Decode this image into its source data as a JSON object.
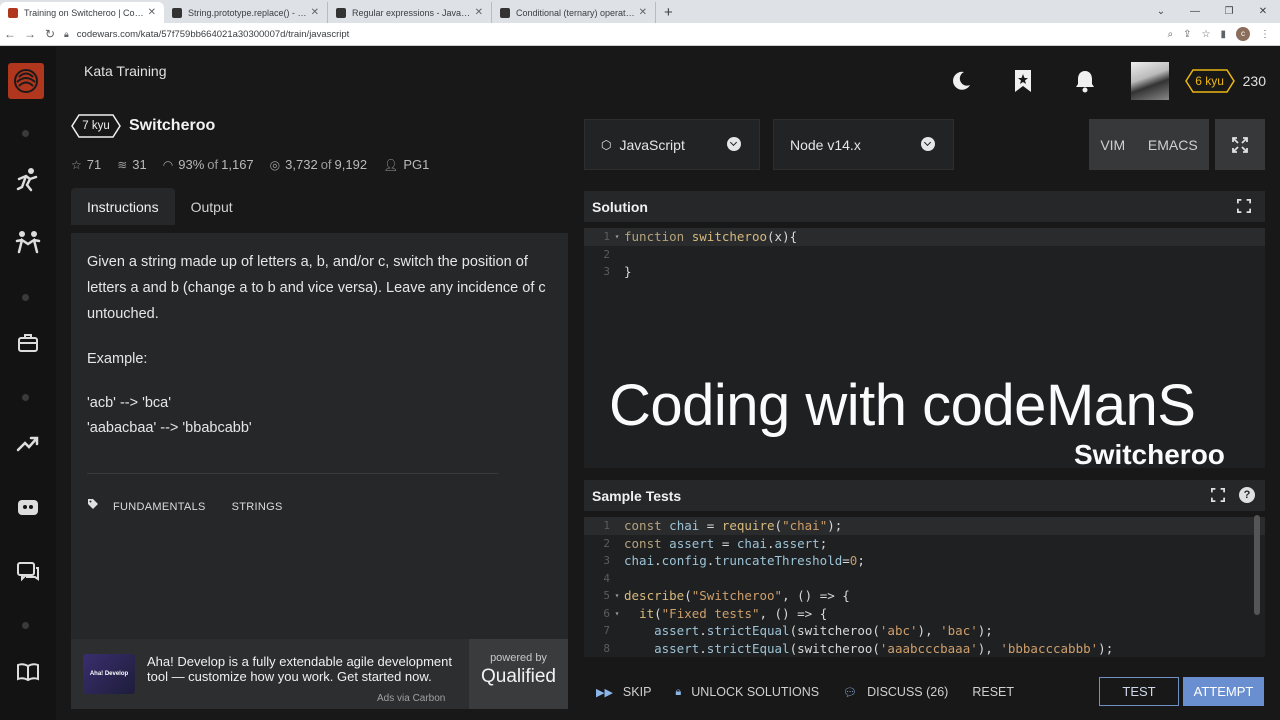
{
  "browser": {
    "tabs": [
      {
        "title": "Training on Switcheroo | Codewars",
        "active": true
      },
      {
        "title": "String.prototype.replace() - JavaScript",
        "active": false
      },
      {
        "title": "Regular expressions - JavaScript",
        "active": false
      },
      {
        "title": "Conditional (ternary) operator - JavaScript",
        "active": false
      }
    ],
    "new_tab": "+",
    "url": "codewars.com/kata/57f759bb664021a30300007d/train/javascript",
    "profile_letter": "c"
  },
  "header": {
    "page_title": "Kata Training",
    "rank": "6 kyu",
    "honor": "230"
  },
  "kata": {
    "kyu": "7 kyu",
    "name": "Switcheroo",
    "stats": {
      "stars": "71",
      "collections": "31",
      "satisfaction": "93%",
      "satisfaction_of": "of",
      "satisfaction_total": "1,167",
      "completed": "3,732",
      "completed_of": "of",
      "completed_total": "9,192",
      "author": "PG1"
    },
    "tabs": [
      "Instructions",
      "Output"
    ],
    "description": [
      "Given a string made up of letters a, b, and/or c, switch the position of letters a and b (change a to b and vice versa). Leave any incidence of c untouched.",
      "Example:"
    ],
    "examples": [
      "'acb' --> 'bca'",
      "'aabacbaa' --> 'bbabcabb'"
    ],
    "tags": [
      "FUNDAMENTALS",
      "STRINGS"
    ]
  },
  "ad": {
    "text": "Aha! Develop is a fully extendable agile development tool — customize how you work. Get started now.",
    "via": "Ads via Carbon",
    "powered_by": "powered by",
    "brand": "Qualified",
    "img_label": "Aha! Develop"
  },
  "editor": {
    "language": "JavaScript",
    "runtime": "Node v14.x",
    "mode_vim": "VIM",
    "mode_emacs": "EMACS",
    "solution_title": "Solution",
    "solution_lines": [
      "function switcheroo(x){",
      "",
      "}"
    ],
    "tests_title": "Sample Tests",
    "tests_lines": [
      "const chai = require(\"chai\");",
      "const assert = chai.assert;",
      "chai.config.truncateThreshold=0;",
      "",
      "describe(\"Switcheroo\", () => {",
      "  it(\"Fixed tests\", () => {",
      "    assert.strictEqual(switcheroo('abc'), 'bac');",
      "    assert.strictEqual(switcheroo('aaabcccbaaa'), 'bbbacccabbb');"
    ]
  },
  "overlay": {
    "title": "Coding with codeManS",
    "subtitle": "Switcheroo"
  },
  "actions": {
    "skip": "SKIP",
    "unlock": "UNLOCK SOLUTIONS",
    "discuss": "DISCUSS (26)",
    "reset": "RESET",
    "test": "TEST",
    "attempt": "ATTEMPT"
  },
  "colors": {
    "brand": "#b1361e",
    "rank_yellow": "#ecb613",
    "attempt_blue": "#6a8fd0"
  }
}
